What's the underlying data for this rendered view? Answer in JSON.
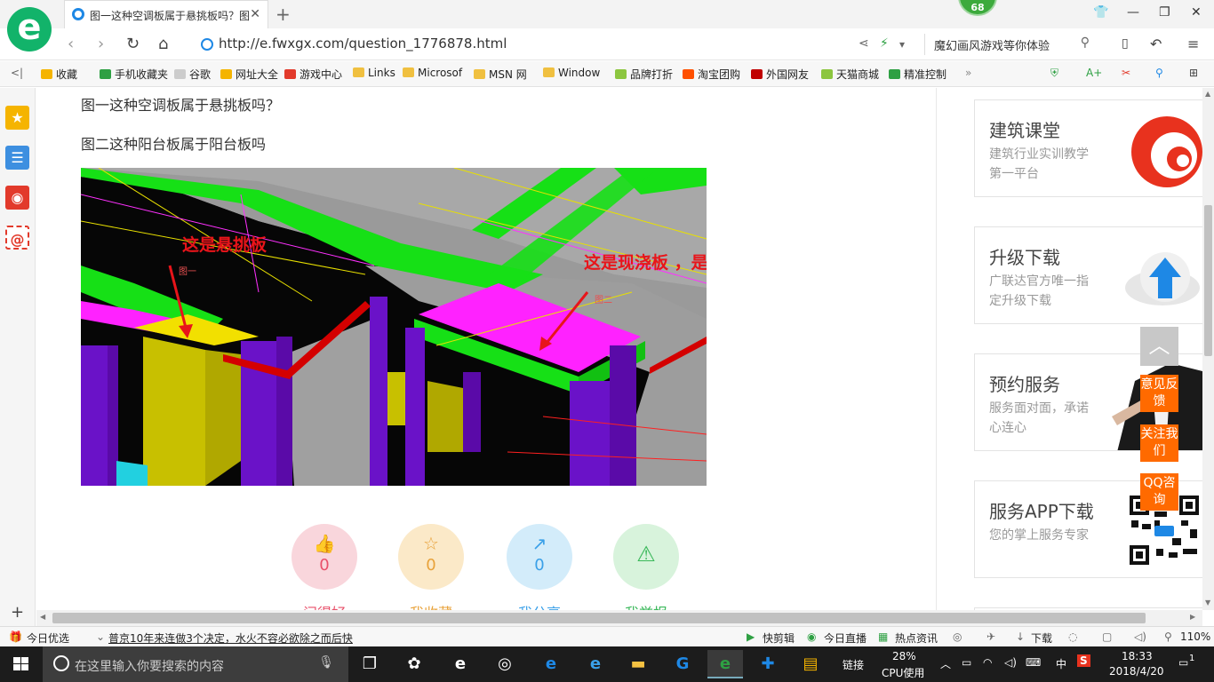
{
  "browser": {
    "tab_title": "图一这种空调板属于悬挑板吗？图",
    "badge": "68",
    "url": "http://e.fwxgx.com/question_1776878.html",
    "search_text": "魔幻画风游戏等你体验"
  },
  "bookmarks": [
    {
      "label": "收藏",
      "color": "#f5b400"
    },
    {
      "label": "手机收藏夹",
      "color": "#2ea043"
    },
    {
      "label": "谷歌",
      "color": "#cccccc"
    },
    {
      "label": "网址大全",
      "color": "#f5b400"
    },
    {
      "label": "游戏中心",
      "color": "#e23a2b"
    },
    {
      "label": "Links",
      "color": "#f0c040"
    },
    {
      "label": "Microsof",
      "color": "#f0c040"
    },
    {
      "label": "MSN 网",
      "color": "#f0c040"
    },
    {
      "label": "Window",
      "color": "#f0c040"
    },
    {
      "label": "品牌打折",
      "color": "#8cc63f"
    },
    {
      "label": "淘宝团购",
      "color": "#ff5000"
    },
    {
      "label": "外国网友",
      "color": "#c00000"
    },
    {
      "label": "天猫商城",
      "color": "#8cc63f"
    },
    {
      "label": "精准控制",
      "color": "#2ea043"
    }
  ],
  "question": {
    "line1": "图一这种空调板属于悬挑板吗？",
    "line2": "图二这种阳台板属于阳台板吗",
    "annotation_left": "这是悬挑板",
    "annotation_right": "这是现浇板 ，是阳台板",
    "fig1_label": "图一",
    "fig2_label": "图二"
  },
  "actions": [
    {
      "count": "0",
      "label": "问得好",
      "color": "#f9d6dc",
      "fg": "#e8506a",
      "icon": "thumbs-up-icon",
      "glyph": "👍"
    },
    {
      "count": "0",
      "label": "我收藏",
      "color": "#fbe9c8",
      "fg": "#e8a23a",
      "icon": "star-icon",
      "glyph": "☆"
    },
    {
      "count": "0",
      "label": "我分享",
      "color": "#d3ecfa",
      "fg": "#3aa0e8",
      "icon": "share-icon",
      "glyph": "↗"
    },
    {
      "count": "",
      "label": "我举报",
      "color": "#d8f3dc",
      "fg": "#3ab85a",
      "icon": "warning-icon",
      "glyph": "⚠"
    }
  ],
  "sidebar_cards": [
    {
      "title": "建筑课堂",
      "desc": "建筑行业实训教学第一平台"
    },
    {
      "title": "升级下载",
      "desc": "广联达官方唯一指定升级下载"
    },
    {
      "title": "预约服务",
      "desc": "服务面对面，承诺心连心"
    },
    {
      "title": "服务APP下载",
      "desc": "您的掌上服务专家"
    }
  ],
  "float_buttons": {
    "feedback": "意见反馈",
    "follow": "关注我们",
    "qq": "QQ咨询"
  },
  "statusbar": {
    "today": "今日优选",
    "news": "普京10年来连做3个决定，水火不容必欲除之而后快",
    "kuaijian": "快剪辑",
    "live": "今日直播",
    "hot": "热点资讯",
    "download": "下载",
    "zoom": "110%"
  },
  "taskbar": {
    "search_placeholder": "在这里输入你要搜索的内容",
    "links": "链接",
    "cpu_percent": "28%",
    "cpu_label": "CPU使用",
    "ime": "中",
    "time": "18:33",
    "date": "2018/4/20",
    "notifications": "1"
  }
}
